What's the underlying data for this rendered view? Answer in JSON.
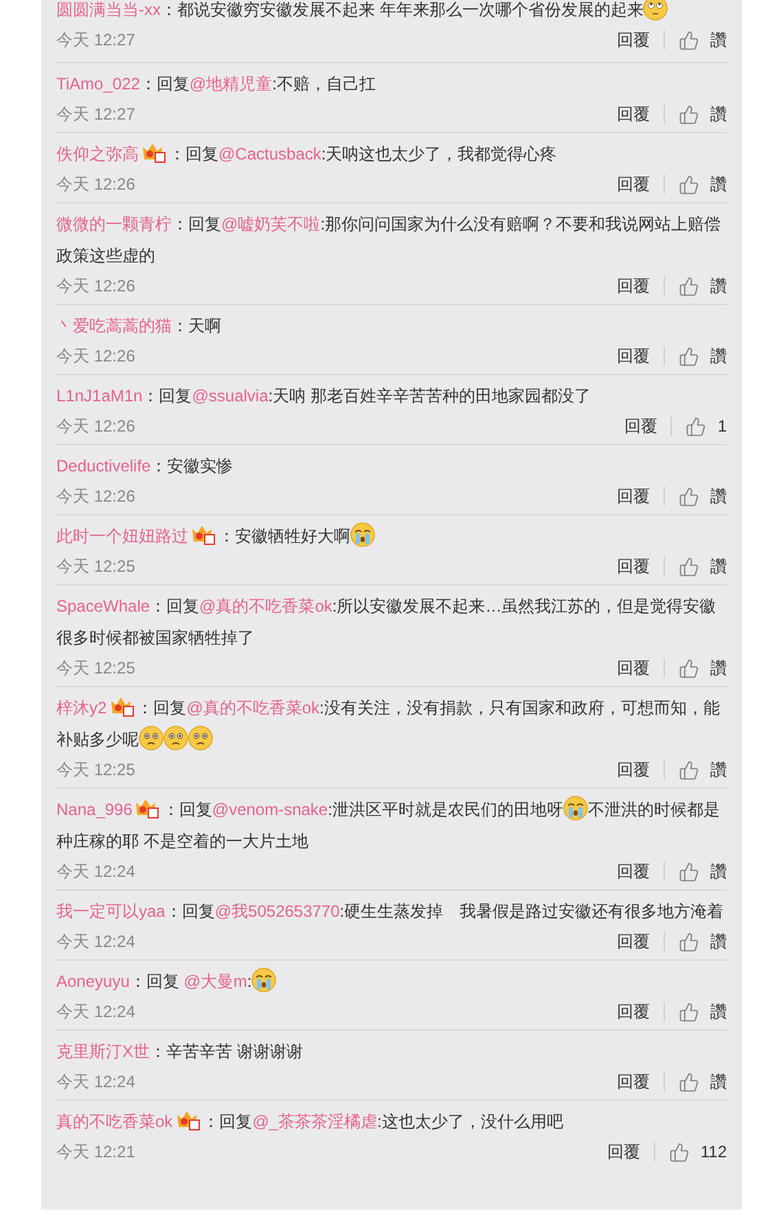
{
  "comments": [
    {
      "user": "圆圆满当当-xx",
      "badge": false,
      "segments": [
        {
          "kind": "text",
          "text": "：都说安徽穷安徽发展不起来 年年来那么一次哪个省份发展的起来"
        },
        {
          "kind": "emoji-rolling-eyes"
        }
      ],
      "time": "今天 12:27",
      "reply": "回覆",
      "likes": "讚"
    },
    {
      "user": "TiAmo_022",
      "badge": false,
      "segments": [
        {
          "kind": "text",
          "text": "：回复"
        },
        {
          "kind": "mention",
          "text": "@地精児童"
        },
        {
          "kind": "text",
          "text": ":不赔，自己扛"
        }
      ],
      "time": "今天 12:27",
      "reply": "回覆",
      "likes": "讚"
    },
    {
      "user": "佚仰之弥高",
      "badge": true,
      "segments": [
        {
          "kind": "text",
          "text": "：回复"
        },
        {
          "kind": "mention",
          "text": "@Cactusback"
        },
        {
          "kind": "text",
          "text": ":天呐这也太少了，我都觉得心疼"
        }
      ],
      "time": "今天 12:26",
      "reply": "回覆",
      "likes": "讚"
    },
    {
      "user": "微微的一颗青柠",
      "badge": false,
      "segments": [
        {
          "kind": "text",
          "text": "：回复"
        },
        {
          "kind": "mention",
          "text": "@嘘奶芙不啦"
        },
        {
          "kind": "text",
          "text": ":那你问问国家为什么没有赔啊？不要和我说网站上赔偿政策这些虚的"
        }
      ],
      "time": "今天 12:26",
      "reply": "回覆",
      "likes": "讚"
    },
    {
      "user": "丶爱吃蒿蒿的猫",
      "badge": false,
      "segments": [
        {
          "kind": "text",
          "text": "：天啊"
        }
      ],
      "time": "今天 12:26",
      "reply": "回覆",
      "likes": "讚"
    },
    {
      "user": "L1nJ1aM1n",
      "badge": false,
      "segments": [
        {
          "kind": "text",
          "text": "：回复"
        },
        {
          "kind": "mention",
          "text": "@ssualvia"
        },
        {
          "kind": "text",
          "text": ":天呐 那老百姓辛辛苦苦种的田地家园都没了"
        }
      ],
      "time": "今天 12:26",
      "reply": "回覆",
      "likes": "1"
    },
    {
      "user": "Deductivelife",
      "badge": false,
      "segments": [
        {
          "kind": "text",
          "text": "：安徽实惨"
        }
      ],
      "time": "今天 12:26",
      "reply": "回覆",
      "likes": "讚"
    },
    {
      "user": "此时一个妞妞路过",
      "badge": true,
      "segments": [
        {
          "kind": "text",
          "text": "：安徽牺牲好大啊"
        },
        {
          "kind": "emoji-crying"
        }
      ],
      "time": "今天 12:25",
      "reply": "回覆",
      "likes": "讚"
    },
    {
      "user": "SpaceWhale",
      "badge": false,
      "segments": [
        {
          "kind": "text",
          "text": "：回复"
        },
        {
          "kind": "mention",
          "text": "@真的不吃香菜ok"
        },
        {
          "kind": "text",
          "text": ":所以安徽发展不起来…虽然我江苏的，但是觉得安徽很多时候都被国家牺牲掉了"
        }
      ],
      "time": "今天 12:25",
      "reply": "回覆",
      "likes": "讚"
    },
    {
      "user": "梓沐y2",
      "badge": true,
      "segments": [
        {
          "kind": "text",
          "text": "：回复"
        },
        {
          "kind": "mention",
          "text": "@真的不吃香菜ok"
        },
        {
          "kind": "text",
          "text": ":没有关注，没有捐款，只有国家和政府，可想而知，能补贴多少呢"
        },
        {
          "kind": "emoji-sad"
        },
        {
          "kind": "emoji-sad"
        },
        {
          "kind": "emoji-sad"
        }
      ],
      "time": "今天 12:25",
      "reply": "回覆",
      "likes": "讚"
    },
    {
      "user": "Nana_996",
      "badge": true,
      "segments": [
        {
          "kind": "text",
          "text": "：回复"
        },
        {
          "kind": "mention",
          "text": "@venom-snake"
        },
        {
          "kind": "text",
          "text": ":泄洪区平时就是农民们的田地呀"
        },
        {
          "kind": "emoji-crying"
        },
        {
          "kind": "text",
          "text": "不泄洪的时候都是种庄稼的耶 不是空着的一大片土地"
        }
      ],
      "time": "今天 12:24",
      "reply": "回覆",
      "likes": "讚"
    },
    {
      "user": "我一定可以yaa",
      "badge": false,
      "segments": [
        {
          "kind": "text",
          "text": "：回复"
        },
        {
          "kind": "mention",
          "text": "@我5052653770"
        },
        {
          "kind": "text",
          "text": ":硬生生蒸发掉　我暑假是路过安徽还有很多地方淹着"
        }
      ],
      "time": "今天 12:24",
      "reply": "回覆",
      "likes": "讚"
    },
    {
      "user": "Aoneyuyu",
      "badge": false,
      "segments": [
        {
          "kind": "text",
          "text": "：回复 "
        },
        {
          "kind": "mention",
          "text": "@大曼m"
        },
        {
          "kind": "text",
          "text": ":"
        },
        {
          "kind": "emoji-crying"
        }
      ],
      "time": "今天 12:24",
      "reply": "回覆",
      "likes": "讚"
    },
    {
      "user": "克里斯汀X世",
      "badge": false,
      "segments": [
        {
          "kind": "text",
          "text": "：辛苦辛苦 谢谢谢谢"
        }
      ],
      "time": "今天 12:24",
      "reply": "回覆",
      "likes": "讚"
    },
    {
      "user": "真的不吃香菜ok",
      "badge": true,
      "segments": [
        {
          "kind": "text",
          "text": "：回复"
        },
        {
          "kind": "mention",
          "text": "@_茶茶茶淫橘虐"
        },
        {
          "kind": "text",
          "text": ":这也太少了，没什么用吧"
        }
      ],
      "time": "今天 12:21",
      "reply": "回覆",
      "likes": "112"
    }
  ]
}
